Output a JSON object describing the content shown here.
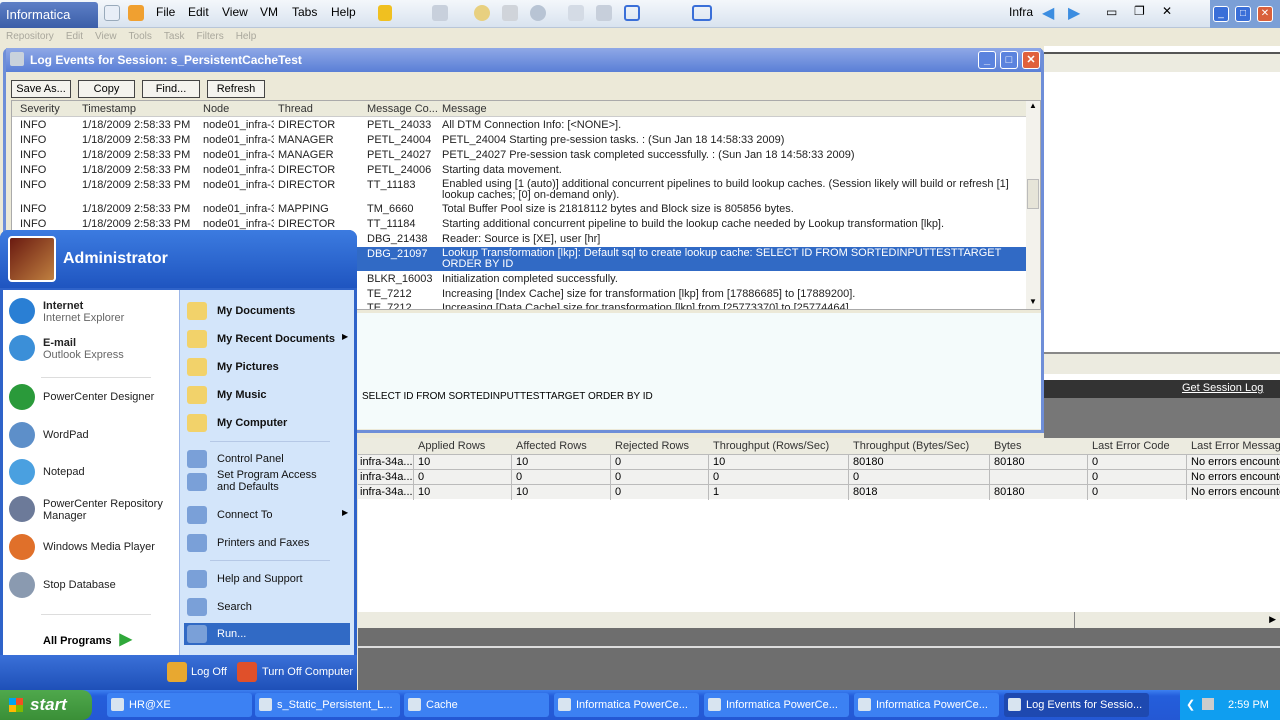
{
  "vm": {
    "tab": "Informatica",
    "menu": [
      "File",
      "Edit",
      "View",
      "VM",
      "Tabs",
      "Help"
    ],
    "user": "Infra"
  },
  "app_menu": [
    "Repository",
    "Edit",
    "View",
    "Tools",
    "Task",
    "Filters",
    "Help"
  ],
  "log_window": {
    "title": "Log Events for Session: s_PersistentCacheTest",
    "buttons": [
      "Save As...",
      "Copy",
      "Find...",
      "Refresh"
    ],
    "columns": [
      "Severity",
      "Timestamp",
      "Node",
      "Thread",
      "Message Co...",
      "Message"
    ],
    "rows": [
      [
        "INFO",
        "1/18/2009 2:58:33 PM",
        "node01_infra-3",
        "DIRECTOR",
        "PETL_24033",
        "All DTM Connection Info: [<NONE>]."
      ],
      [
        "INFO",
        "1/18/2009 2:58:33 PM",
        "node01_infra-3",
        "MANAGER",
        "PETL_24004",
        "PETL_24004 Starting pre-session tasks. : (Sun Jan 18 14:58:33 2009)"
      ],
      [
        "INFO",
        "1/18/2009 2:58:33 PM",
        "node01_infra-3",
        "MANAGER",
        "PETL_24027",
        "PETL_24027 Pre-session task completed successfully. : (Sun Jan 18 14:58:33 2009)"
      ],
      [
        "INFO",
        "1/18/2009 2:58:33 PM",
        "node01_infra-3",
        "DIRECTOR",
        "PETL_24006",
        "Starting data movement."
      ],
      [
        "INFO",
        "1/18/2009 2:58:33 PM",
        "node01_infra-3",
        "DIRECTOR",
        "TT_11183",
        "Enabled using [1 (auto)] additional concurrent pipelines to build lookup caches. (Session likely will build or refresh [1] lookup caches; [0] on-demand only)."
      ],
      [
        "INFO",
        "1/18/2009 2:58:33 PM",
        "node01_infra-3",
        "MAPPING",
        "TM_6660",
        "Total Buffer Pool size is 21818112 bytes and Block size is 805856 bytes."
      ],
      [
        "INFO",
        "1/18/2009 2:58:33 PM",
        "node01_infra-3",
        "DIRECTOR",
        "TT_11184",
        "Starting additional concurrent pipeline to build the lookup cache needed by Lookup transformation [lkp]."
      ],
      [
        "",
        "",
        "",
        "",
        "DBG_21438",
        "Reader: Source is [XE], user [hr]"
      ],
      [
        "",
        "",
        "",
        "",
        "DBG_21097",
        "Lookup Transformation [lkp]: Default sql to create lookup cache: SELECT ID FROM SORTEDINPUTTESTTARGET ORDER BY ID"
      ],
      [
        "",
        "",
        "",
        "",
        "BLKR_16003",
        "Initialization completed successfully."
      ],
      [
        "",
        "",
        "",
        "",
        "TE_7212",
        "Increasing [Index Cache] size for transformation [lkp] from [17886685] to [17889200]."
      ],
      [
        "",
        "",
        "",
        "",
        "TE_7212",
        "Increasing [Data Cache] size for transformation [lkp] from [25773370] to [25774464]."
      ]
    ],
    "detail": "SELECT ID FROM SORTEDINPUTTESTTARGET ORDER BY ID"
  },
  "get_session_log": "Get Session Log",
  "stats": {
    "columns": [
      "Applied Rows",
      "Affected Rows",
      "Rejected Rows",
      "Throughput (Rows/Sec)",
      "Throughput (Bytes/Sec)",
      "Bytes",
      "Last Error Code",
      "Last Error Message"
    ],
    "rows": [
      [
        "infra-34a...",
        "10",
        "10",
        "0",
        "10",
        "80180",
        "80180",
        "0",
        "No errors encounte"
      ],
      [
        "infra-34a...",
        "0",
        "0",
        "0",
        "0",
        "0",
        "",
        "0",
        "No errors encounte"
      ],
      [
        "infra-34a...",
        "10",
        "10",
        "0",
        "1",
        "8018",
        "80180",
        "0",
        "No errors encounte"
      ]
    ]
  },
  "start_menu": {
    "user": "Administrator",
    "left": [
      {
        "title": "Internet",
        "sub": "Internet Explorer",
        "color": "#2a7fd4"
      },
      {
        "title": "E-mail",
        "sub": "Outlook Express",
        "color": "#3b8fd8"
      },
      {
        "title": "PowerCenter Designer",
        "color": "#2a9a3a"
      },
      {
        "title": "WordPad",
        "color": "#5d8fc9"
      },
      {
        "title": "Notepad",
        "color": "#4aa0e0"
      },
      {
        "title": "PowerCenter Repository Manager",
        "color": "#6c7a99"
      },
      {
        "title": "Windows Media Player",
        "color": "#e0702a"
      },
      {
        "title": "Stop Database",
        "color": "#8a9ab0"
      }
    ],
    "all_programs": "All Programs",
    "right": [
      {
        "label": "My Documents",
        "bold": true
      },
      {
        "label": "My Recent Documents",
        "bold": true,
        "arrow": true
      },
      {
        "label": "My Pictures",
        "bold": true
      },
      {
        "label": "My Music",
        "bold": true
      },
      {
        "label": "My Computer",
        "bold": true
      },
      {
        "label": "Control Panel"
      },
      {
        "label": "Set Program Access and Defaults"
      },
      {
        "label": "Connect To",
        "arrow": true
      },
      {
        "label": "Printers and Faxes"
      },
      {
        "label": "Help and Support"
      },
      {
        "label": "Search"
      },
      {
        "label": "Run..."
      }
    ],
    "log_off": "Log Off",
    "turn_off": "Turn Off Computer"
  },
  "taskbar": {
    "start": "start",
    "tasks": [
      "HR@XE",
      "s_Static_Persistent_L...",
      "Cache",
      "Informatica PowerCe...",
      "Informatica PowerCe...",
      "Informatica PowerCe...",
      "Log Events for Sessio..."
    ],
    "clock": "2:59 PM"
  }
}
